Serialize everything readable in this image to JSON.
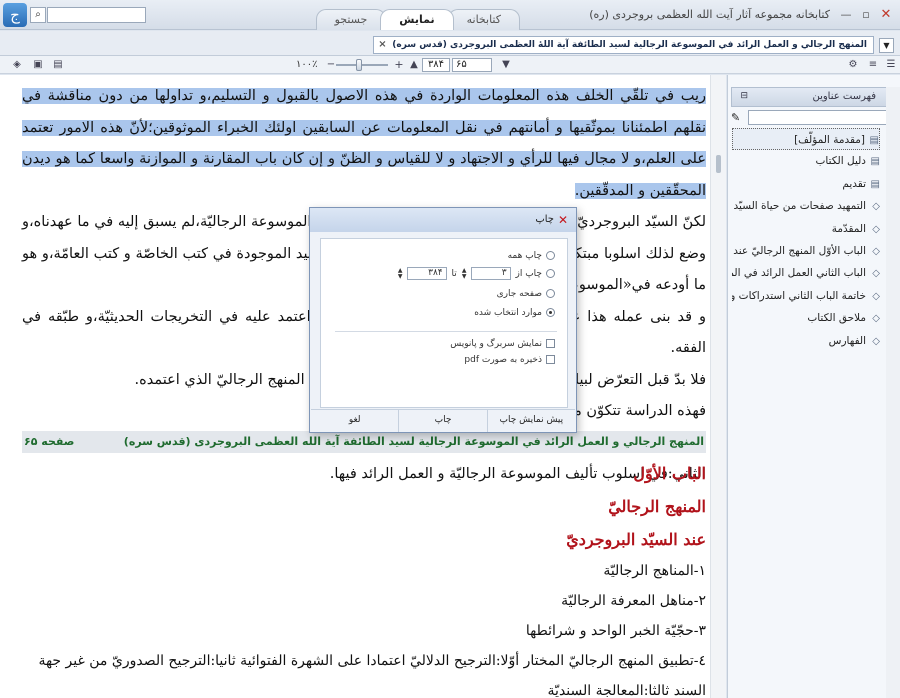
{
  "window": {
    "title": "کتابخانه مجموعه آثار آیت الله العظمی بروجردی (ره)",
    "logo": "ج",
    "search_value": "",
    "minimize_icon": "—",
    "maximize_icon": "▫",
    "close_icon": "✕"
  },
  "tabs": [
    {
      "label": "کتابخانه",
      "active": false
    },
    {
      "label": "نمایش",
      "active": true
    },
    {
      "label": "جستجو",
      "active": false
    }
  ],
  "doc_tab": {
    "label": "المنهج الرجالي و العمل الرائد في الموسوعة الرجالية لسيد الطائفة آية اللهٔ العظمى البروجردى (قدس سره)",
    "close": "×",
    "menu": "▼"
  },
  "toolbar": {
    "zoom": "۱۰۰٪",
    "zoom_minus": "−",
    "zoom_plus": "+",
    "page_total": "۳۸۴",
    "page_current": "۶۵"
  },
  "reader": {
    "selected_text": "ريب في تلقّي الخلف هذه المعلومات الواردة في هذه الاصول بالقبول و التسليم،و تداولها من دون مناقشة في نقلهم اطمئنانا بموثّقيها و أمانتهم في نقل المعلومات عن السابقين اولئك الخبراء الموثوقين؛لأنّ هذه الامور تعتمد على العلم،و لا مجال فيها للرأي و الاجتهاد و لا للقياس و الظنّ و إن كان باب المقارنة و الموازنة واسعا كما هو ديدن المحقّقين و المدقّقين.",
    "paragraphs": [
      "لكنّ السيّد البروجرديّ لم يقتصر على اعتماد ذلك المنهج في تأليف الموسوعة الرجاليّة،لم يسبق إليه في ما عهدناه،و وضع لذلك اسلوبا مبتكرا غير معروف لدى الرجاليّين،فقد جمع الأسانيد الموجودة في كتب الخاصّة و كتب العامّة،و هو ما أودعه في«الموسوعة الرجاليّة».",
      "و قد بنى عمله هذا على معرفة الطبقات و تمييز المشتركات،و اعتمد عليه في التخريجات الحديثيّة،و طبّقه في الفقه.",
      "فلا بدّ قبل التعرّض لبيان تفاصيل هذا المنهج من التعرّف على حقيقة المنهج الرجاليّ الذي اعتمده.",
      "فهذه الدراسة تتكوّن من بابين:",
      "الأوّل:في بيان المنهج الرجاليّ عند السيّد البروجرديّ.",
      "الثاني:في اسلوب تأليف الموسوعة الرجاليّة و العمل الرائد فيها."
    ],
    "footer_title": "المنهج الرجالي و العمل الرائد في الموسوعة الرجالية لسيد الطائفة آية الله العظمى البروجردى (قدس سره)",
    "footer_page": "صفحه ۶۵",
    "headings": [
      "الباب الأوّل",
      "المنهج الرجاليّ",
      "عند السيّد البروجرديّ"
    ],
    "items": [
      "١-المناهج الرجاليّة",
      "٢-مناهل المعرفة الرجاليّة",
      "٣-حجّيّة الخبر الواحد و شرائطها",
      "٤-تطبيق المنهج الرجاليّ المختار أوّلا:الترجيح الدلاليّ اعتمادا على الشهرة الفتوائية ثانيا:الترجيح الصدوريّ من غير جهة السند ثالثا:المعالجة السنديّة"
    ]
  },
  "side": {
    "header": "فهرست عناوین",
    "toc": [
      {
        "label": "[مقدمة المؤلّف]",
        "icon": "page-icon"
      },
      {
        "label": "دليل الكتاب",
        "icon": "page-icon"
      },
      {
        "label": "تقديم",
        "icon": "page-icon"
      },
      {
        "label": "التمهيد صفحات من حياة السيّد الإ",
        "icon": "folder-icon"
      },
      {
        "label": "المقدّمة",
        "icon": "folder-icon"
      },
      {
        "label": "الباب الأوّل المنهج الرجاليّ عند الس",
        "icon": "folder-icon"
      },
      {
        "label": "الباب الثاني العمل الرائد في الموس",
        "icon": "folder-icon"
      },
      {
        "label": "خاتمة الباب الثاني استدراكات و تذ",
        "icon": "folder-icon"
      },
      {
        "label": "ملاحق الكتاب",
        "icon": "folder-icon"
      },
      {
        "label": "الفهارس",
        "icon": "folder-icon"
      }
    ]
  },
  "print_dialog": {
    "title": "چاپ",
    "close": "✕",
    "options": {
      "all": "چاپ همه",
      "range_from": "چاپ از",
      "range_from_value": "۳",
      "range_to": "تا",
      "range_to_value": "۳۸۴",
      "current": "صفحه جاری",
      "selection": "موارد انتخاب شده"
    },
    "checks": {
      "header_footer": "نمایش سربرگ و پانویس",
      "save_pdf": "ذخیره به صورت pdf"
    },
    "buttons": {
      "preview": "پیش نمایش چاپ",
      "print": "چاپ",
      "cancel": "لغو"
    }
  }
}
